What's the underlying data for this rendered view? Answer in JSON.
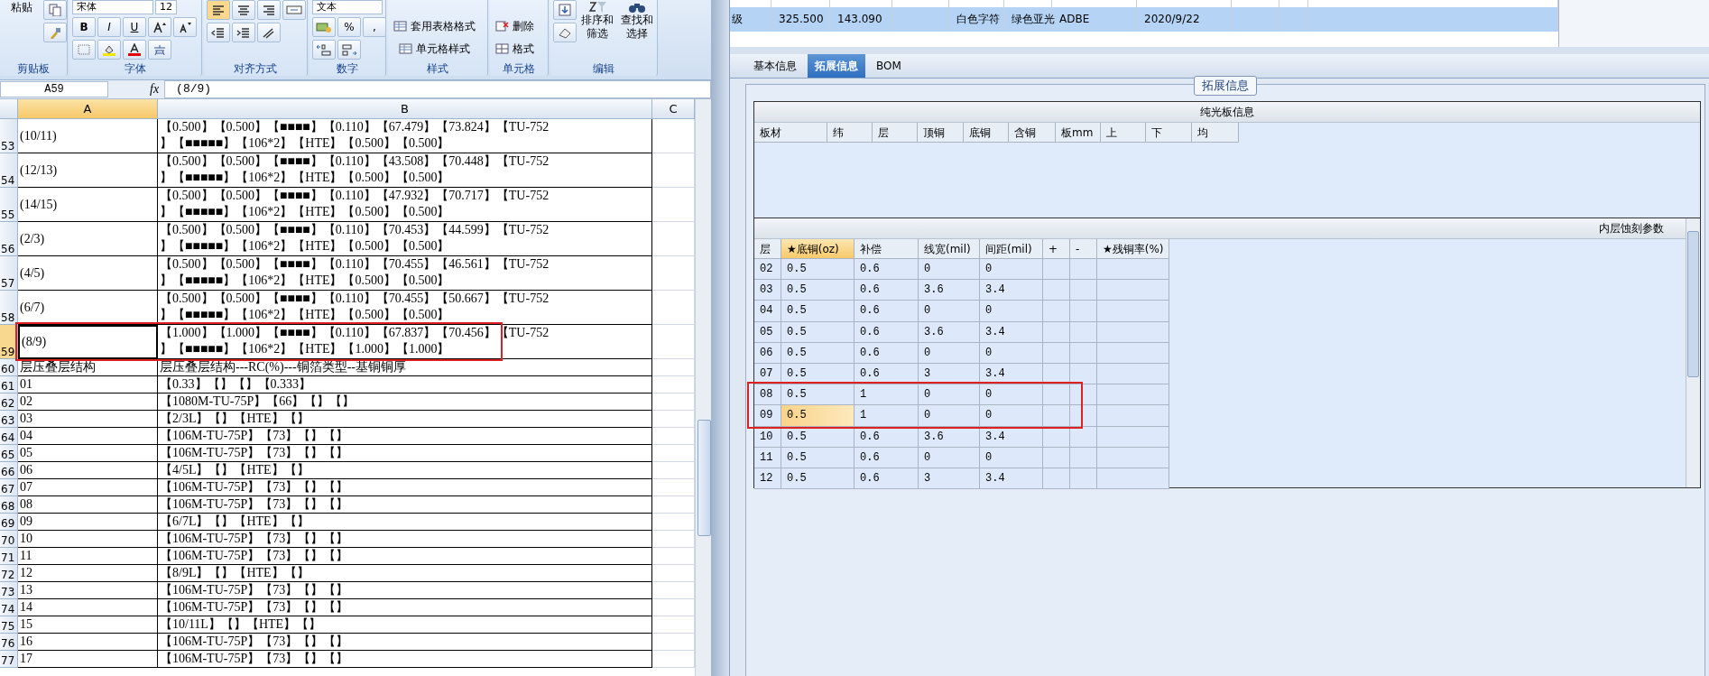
{
  "ribbon": {
    "clipboard": {
      "label": "剪贴板",
      "paste": "粘贴"
    },
    "font": {
      "label": "字体",
      "font_name": "宋体",
      "font_size": "12",
      "bold": "B",
      "italic": "I",
      "underline": "U"
    },
    "alignment": {
      "label": "对齐方式"
    },
    "number": {
      "label": "数字",
      "number_format": "文本",
      "percent": "%",
      "comma": ","
    },
    "styles": {
      "label": "样式",
      "buttons": [
        "套用表格格式",
        "单元格样式"
      ]
    },
    "cells": {
      "label": "单元格",
      "buttons": [
        "删除",
        "格式"
      ]
    },
    "editing": {
      "label": "编辑",
      "buttons": [
        "排序和筛选",
        "查找和选择"
      ]
    }
  },
  "formula_bar": {
    "name_box": "A59",
    "fx": "fx",
    "formula": "(8/9)"
  },
  "sheet": {
    "columns": [
      {
        "label": "A",
        "selected": true
      },
      {
        "label": "B",
        "selected": false
      },
      {
        "label": "C",
        "selected": false
      }
    ],
    "rows": [
      {
        "header": "53",
        "tall": true,
        "selected": false,
        "cells": [
          "(10/11)",
          "【0.500】【0.500】【■■■■】【0.110】【67.479】【73.824】【TU-752\n】【■■■■■】【106*2】【HTE】【0.500】【0.500】"
        ]
      },
      {
        "header": "54",
        "tall": true,
        "selected": false,
        "cells": [
          "(12/13)",
          "【0.500】【0.500】【■■■■】【0.110】【43.508】【70.448】【TU-752\n】【■■■■■】【106*2】【HTE】【0.500】【0.500】"
        ]
      },
      {
        "header": "55",
        "tall": true,
        "selected": false,
        "cells": [
          "(14/15)",
          "【0.500】【0.500】【■■■■】【0.110】【47.932】【70.717】【TU-752\n】【■■■■■】【106*2】【HTE】【0.500】【0.500】"
        ]
      },
      {
        "header": "56",
        "tall": true,
        "selected": false,
        "cells": [
          "(2/3)",
          "【0.500】【0.500】【■■■■】【0.110】【70.453】【44.599】【TU-752\n】【■■■■■】【106*2】【HTE】【0.500】【0.500】"
        ]
      },
      {
        "header": "57",
        "tall": true,
        "selected": false,
        "cells": [
          "(4/5)",
          "【0.500】【0.500】【■■■■】【0.110】【70.455】【46.561】【TU-752\n】【■■■■■】【106*2】【HTE】【0.500】【0.500】"
        ]
      },
      {
        "header": "58",
        "tall": true,
        "selected": false,
        "cells": [
          "(6/7)",
          "【0.500】【0.500】【■■■■】【0.110】【70.455】【50.667】【TU-752\n】【■■■■■】【106*2】【HTE】【0.500】【0.500】"
        ]
      },
      {
        "header": "59",
        "tall": true,
        "selected": true,
        "cells": [
          "(8/9)",
          "【1.000】【1.000】【■■■■】【0.110】【67.837】【70.456】【TU-752\n】【■■■■■】【106*2】【HTE】【1.000】【1.000】"
        ]
      },
      {
        "header": "60",
        "tall": false,
        "selected": false,
        "cells": [
          "层压叠层结构",
          "层压叠层结构---RC(%)---铜箔类型--基铜铜厚"
        ]
      },
      {
        "header": "61",
        "tall": false,
        "selected": false,
        "cells": [
          "01",
          "【0.33】【】【】【0.333】"
        ]
      },
      {
        "header": "62",
        "tall": false,
        "selected": false,
        "cells": [
          "02",
          "【1080M-TU-75P】【66】【】【】"
        ]
      },
      {
        "header": "63",
        "tall": false,
        "selected": false,
        "cells": [
          "03",
          "【2/3L】【】【HTE】【】"
        ]
      },
      {
        "header": "64",
        "tall": false,
        "selected": false,
        "cells": [
          "04",
          "【106M-TU-75P】【73】【】【】"
        ]
      },
      {
        "header": "65",
        "tall": false,
        "selected": false,
        "cells": [
          "05",
          "【106M-TU-75P】【73】【】【】"
        ]
      },
      {
        "header": "66",
        "tall": false,
        "selected": false,
        "cells": [
          "06",
          "【4/5L】【】【HTE】【】"
        ]
      },
      {
        "header": "67",
        "tall": false,
        "selected": false,
        "cells": [
          "07",
          "【106M-TU-75P】【73】【】【】"
        ]
      },
      {
        "header": "68",
        "tall": false,
        "selected": false,
        "cells": [
          "08",
          "【106M-TU-75P】【73】【】【】"
        ]
      },
      {
        "header": "69",
        "tall": false,
        "selected": false,
        "cells": [
          "09",
          "【6/7L】【】【HTE】【】"
        ]
      },
      {
        "header": "70",
        "tall": false,
        "selected": false,
        "cells": [
          "10",
          "【106M-TU-75P】【73】【】【】"
        ]
      },
      {
        "header": "71",
        "tall": false,
        "selected": false,
        "cells": [
          "11",
          "【106M-TU-75P】【73】【】【】"
        ]
      },
      {
        "header": "72",
        "tall": false,
        "selected": false,
        "cells": [
          "12",
          "【8/9L】【】【HTE】【】"
        ]
      },
      {
        "header": "73",
        "tall": false,
        "selected": false,
        "cells": [
          "13",
          "【106M-TU-75P】【73】【】【】"
        ]
      },
      {
        "header": "74",
        "tall": false,
        "selected": false,
        "cells": [
          "14",
          "【106M-TU-75P】【73】【】【】"
        ]
      },
      {
        "header": "75",
        "tall": false,
        "selected": false,
        "cells": [
          "15",
          "【10/11L】【】【HTE】【】"
        ]
      },
      {
        "header": "76",
        "tall": false,
        "selected": false,
        "cells": [
          "16",
          "【106M-TU-75P】【73】【】【】"
        ]
      },
      {
        "header": "77",
        "tall": false,
        "selected": false,
        "cells": [
          "17",
          "【106M-TU-75P】【73】【】【】"
        ]
      }
    ]
  },
  "order_grid": {
    "row": {
      "selected": true,
      "cells": [
        "级",
        "325.500",
        "143.090",
        "白色字符",
        "绿色亚光",
        "ADBE",
        "2020/9/22"
      ]
    }
  },
  "tabs": [
    {
      "label": "基本信息",
      "selected": false
    },
    {
      "label": "拓展信息",
      "selected": true
    },
    {
      "label": "BOM",
      "selected": false
    }
  ],
  "group_title": "拓展信息",
  "plain_board": {
    "title": "纯光板信息",
    "columns": [
      "板材",
      "纬",
      "层",
      "顶铜",
      "底铜",
      "含铜",
      "板mm",
      "上",
      "下",
      "均"
    ]
  },
  "etch": {
    "title": "内层蚀刻参数",
    "columns": [
      {
        "label": "层",
        "selected": false
      },
      {
        "label": "★底铜(oz)",
        "selected": true
      },
      {
        "label": "补偿",
        "selected": false
      },
      {
        "label": "线宽(mil)",
        "selected": false
      },
      {
        "label": "间距(mil)",
        "selected": false
      },
      {
        "label": "+",
        "selected": false
      },
      {
        "label": "-",
        "selected": false
      },
      {
        "label": "★残铜率(%)",
        "selected": false
      }
    ],
    "rows": [
      {
        "selected": false,
        "cells": [
          "02",
          "0.5",
          "0.6",
          "0",
          "0"
        ]
      },
      {
        "selected": false,
        "cells": [
          "03",
          "0.5",
          "0.6",
          "3.6",
          "3.4"
        ]
      },
      {
        "selected": false,
        "cells": [
          "04",
          "0.5",
          "0.6",
          "0",
          "0"
        ]
      },
      {
        "selected": false,
        "cells": [
          "05",
          "0.5",
          "0.6",
          "3.6",
          "3.4"
        ]
      },
      {
        "selected": false,
        "cells": [
          "06",
          "0.5",
          "0.6",
          "0",
          "0"
        ]
      },
      {
        "selected": false,
        "cells": [
          "07",
          "0.5",
          "0.6",
          "3",
          "3.4"
        ]
      },
      {
        "selected": false,
        "cells": [
          "08",
          "0.5",
          "1",
          "0",
          "0"
        ]
      },
      {
        "selected": true,
        "cells": [
          "09",
          "0.5",
          "1",
          "0",
          "0"
        ]
      },
      {
        "selected": false,
        "cells": [
          "10",
          "0.5",
          "0.6",
          "3.6",
          "3.4"
        ]
      },
      {
        "selected": false,
        "cells": [
          "11",
          "0.5",
          "0.6",
          "0",
          "0"
        ]
      },
      {
        "selected": false,
        "cells": [
          "12",
          "0.5",
          "0.6",
          "3",
          "3.4"
        ]
      }
    ]
  }
}
